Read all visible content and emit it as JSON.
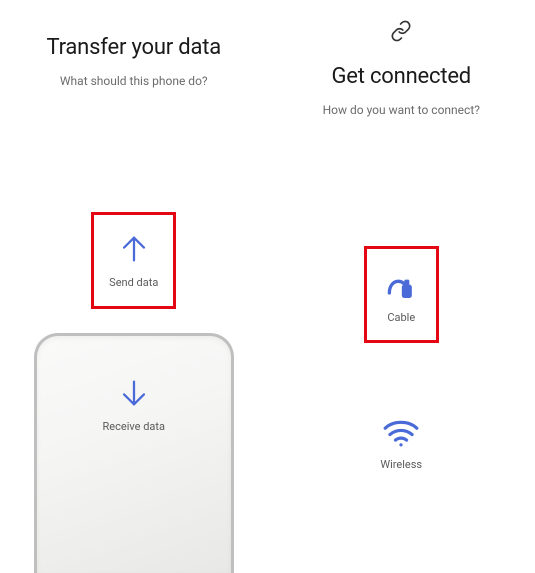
{
  "left": {
    "title": "Transfer your data",
    "subtitle": "What should this phone do?",
    "options": {
      "send": {
        "label": "Send data",
        "highlighted": true
      },
      "receive": {
        "label": "Receive data",
        "highlighted": false
      }
    }
  },
  "right": {
    "title": "Get connected",
    "subtitle": "How do you want to connect?",
    "options": {
      "cable": {
        "label": "Cable",
        "highlighted": true
      },
      "wireless": {
        "label": "Wireless",
        "highlighted": false
      }
    }
  },
  "colors": {
    "accent": "#4a6ad8",
    "highlight": "#e30613"
  }
}
